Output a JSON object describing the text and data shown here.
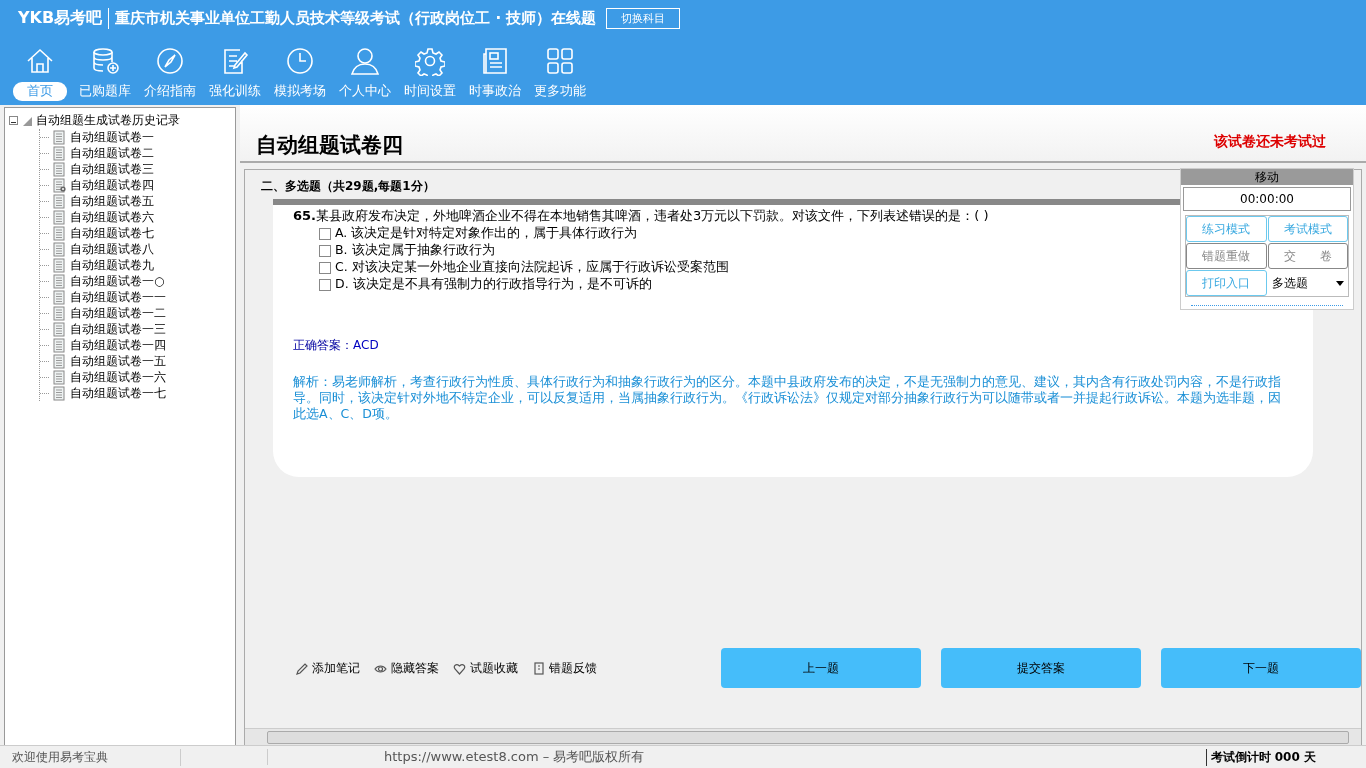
{
  "app": {
    "logo": "YKB易考吧",
    "title": "重庆市机关事业单位工勤人员技术等级考试（行政岗位工 · 技师）在线题",
    "switch_button": "切换科目"
  },
  "nav": [
    {
      "label": "首页",
      "kind": "home",
      "selected": true
    },
    {
      "label": "已购题库",
      "kind": "database",
      "selected": false
    },
    {
      "label": "介绍指南",
      "kind": "compass",
      "selected": false
    },
    {
      "label": "强化训练",
      "kind": "edit",
      "selected": false
    },
    {
      "label": "模拟考场",
      "kind": "clock",
      "selected": false
    },
    {
      "label": "个人中心",
      "kind": "user",
      "selected": false
    },
    {
      "label": "时间设置",
      "kind": "gear",
      "selected": false
    },
    {
      "label": "时事政治",
      "kind": "news",
      "selected": false
    },
    {
      "label": "更多功能",
      "kind": "grid",
      "selected": false
    }
  ],
  "tree": {
    "label": "自动组题生成试卷历史记录",
    "expanded": true,
    "children": [
      {
        "label": "自动组题试卷一",
        "selected": false
      },
      {
        "label": "自动组题试卷二",
        "selected": false
      },
      {
        "label": "自动组题试卷三",
        "selected": false
      },
      {
        "label": "自动组题试卷四",
        "selected": true
      },
      {
        "label": "自动组题试卷五",
        "selected": false
      },
      {
        "label": "自动组题试卷六",
        "selected": false
      },
      {
        "label": "自动组题试卷七",
        "selected": false
      },
      {
        "label": "自动组题试卷八",
        "selected": false
      },
      {
        "label": "自动组题试卷九",
        "selected": false
      },
      {
        "label": "自动组题试卷一○",
        "selected": false
      },
      {
        "label": "自动组题试卷一一",
        "selected": false
      },
      {
        "label": "自动组题试卷一二",
        "selected": false
      },
      {
        "label": "自动组题试卷一三",
        "selected": false
      },
      {
        "label": "自动组题试卷一四",
        "selected": false
      },
      {
        "label": "自动组题试卷一五",
        "selected": false
      },
      {
        "label": "自动组题试卷一六",
        "selected": false
      },
      {
        "label": "自动组题试卷一七",
        "selected": false
      }
    ]
  },
  "paper": {
    "title": "自动组题试卷四",
    "status": "该试卷还未考试过",
    "section": "二、多选题（共29题,每题1分）",
    "question": {
      "number": "65.",
      "text": "某县政府发布决定，外地啤酒企业不得在本地销售其啤酒，违者处3万元以下罚款。对该文件，下列表述错误的是：( )",
      "options": [
        {
          "text": "A. 该决定是针对特定对象作出的，属于具体行政行为",
          "checked": false
        },
        {
          "text": "B. 该决定属于抽象行政行为",
          "checked": false
        },
        {
          "text": "C. 对该决定某一外地企业直接向法院起诉，应属于行政诉讼受案范围",
          "checked": false
        },
        {
          "text": "D. 该决定是不具有强制力的行政指导行为，是不可诉的",
          "checked": false
        }
      ]
    },
    "answer_label": "正确答案：",
    "answer": "ACD",
    "analysis": "解析：易老师解析，考查行政行为性质、具体行政行为和抽象行政行为的区分。本题中县政府发布的决定，不是无强制力的意见、建议，其内含有行政处罚内容，不是行政指导。同时，该决定针对外地不特定企业，可以反复适用，当属抽象行政行为。《行政诉讼法》仅规定对部分抽象行政行为可以随带或者一并提起行政诉讼。本题为选非题，因此选A、C、D项。"
  },
  "tools": [
    {
      "label": "添加笔记",
      "kind": "pencil"
    },
    {
      "label": "隐藏答案",
      "kind": "eye"
    },
    {
      "label": "试题收藏",
      "kind": "heart"
    },
    {
      "label": "错题反馈",
      "kind": "flag"
    }
  ],
  "buttons": [
    "上一题",
    "提交答案",
    "下一题"
  ],
  "panel": {
    "handle": "移动",
    "timer": "00:00:00",
    "buttons": [
      {
        "label": "练习模式",
        "disabled": false
      },
      {
        "label": "考试模式",
        "disabled": false
      },
      {
        "label": "错题重做",
        "disabled": true
      },
      {
        "label": "交　　卷",
        "disabled": true
      },
      {
        "label": "打印入口",
        "disabled": false
      }
    ],
    "type_select": "多选题"
  },
  "status_bar": {
    "welcome": "欢迎使用易考宝典",
    "copyright": "https://www.etest8.com – 易考吧版权所有",
    "countdown": "考试倒计时 000 天"
  }
}
